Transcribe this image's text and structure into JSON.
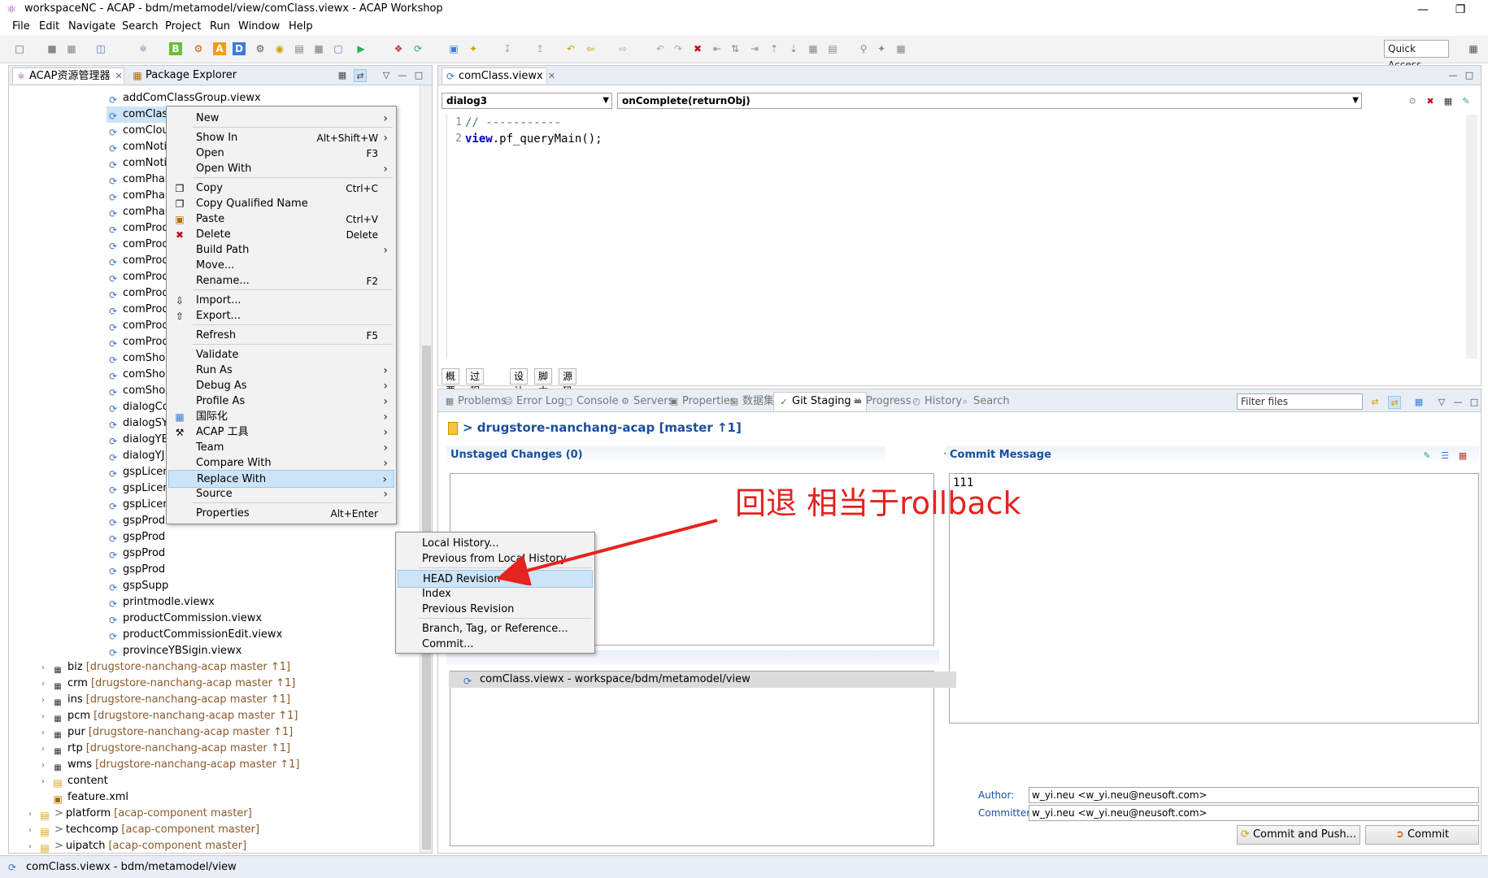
{
  "window": {
    "title": "workspaceNC - ACAP - bdm/metamodel/view/comClass.viewx - ACAP Workshop",
    "minimize": "—",
    "restore": "❐"
  },
  "menubar": [
    "File",
    "Edit",
    "Navigate",
    "Search",
    "Project",
    "Run",
    "Window",
    "Help"
  ],
  "toolbar": {
    "quick_access": "Quick Access"
  },
  "left_panel": {
    "tabs": [
      {
        "label": "ACAP资源管理器",
        "close": "✕"
      },
      {
        "label": "Package Explorer"
      }
    ],
    "tree_items": [
      "addComClassGroup.viewx",
      "comClass",
      "comClou",
      "comNoti",
      "comNoti",
      "comPhar",
      "comPhar",
      "comPhar",
      "comProd",
      "comProd",
      "comProd",
      "comProd",
      "comProd",
      "comProd",
      "comProd",
      "comProd",
      "comShop",
      "comShop",
      "comShop",
      "dialogCo",
      "dialogSY",
      "dialogYB",
      "dialogYJ",
      "gspLicen",
      "gspLicen",
      "gspLicen",
      "gspProd",
      "gspProd",
      "gspProd",
      "gspProd",
      "gspSupp",
      "printmodle.viewx",
      "productCommission.viewx",
      "productCommissionEdit.viewx",
      "provinceYBSigin.viewx"
    ],
    "projects": [
      {
        "name": "biz",
        "git": "[drugstore-nanchang-acap master ↑1]"
      },
      {
        "name": "crm",
        "git": "[drugstore-nanchang-acap master ↑1]"
      },
      {
        "name": "ins",
        "git": "[drugstore-nanchang-acap master ↑1]"
      },
      {
        "name": "pcm",
        "git": "[drugstore-nanchang-acap master ↑1]"
      },
      {
        "name": "pur",
        "git": "[drugstore-nanchang-acap master ↑1]"
      },
      {
        "name": "rtp",
        "git": "[drugstore-nanchang-acap master ↑1]"
      },
      {
        "name": "wms",
        "git": "[drugstore-nanchang-acap master ↑1]"
      }
    ],
    "folders": [
      "content",
      "feature.xml"
    ],
    "root_projects": [
      {
        "name": "platform",
        "git": "[acap-component master]"
      },
      {
        "name": "techcomp",
        "git": "[acap-component master]"
      },
      {
        "name": "uipatch",
        "git": "[acap-component master]"
      }
    ]
  },
  "status_bar": {
    "text": "comClass.viewx - bdm/metamodel/view"
  },
  "editor": {
    "tab": "comClass.viewx",
    "tab_close": "✕",
    "select_left": "dialog3",
    "select_right": "onComplete(returnObj)",
    "lines": [
      {
        "no": "1",
        "text": "// -----------"
      },
      {
        "no": "2",
        "kw": "view",
        "rest": ".pf_queryMain();"
      }
    ],
    "bottom_tabs": [
      "概要",
      "过程调用",
      "设计",
      "脚本",
      "源码"
    ]
  },
  "bottom_panel": {
    "tabs": [
      {
        "label": "Problems",
        "icon": "problems-icon"
      },
      {
        "label": "Error Log",
        "icon": "error-log-icon"
      },
      {
        "label": "Console",
        "icon": "console-icon"
      },
      {
        "label": "Servers",
        "icon": "servers-icon"
      },
      {
        "label": "Properties",
        "icon": "properties-icon"
      },
      {
        "label": "数据集",
        "icon": "dataset-icon"
      },
      {
        "label": "Git Staging",
        "icon": "git-staging-icon",
        "active": true
      },
      {
        "label": "Progress",
        "icon": "progress-icon"
      },
      {
        "label": "History",
        "icon": "history-icon"
      },
      {
        "label": "Search",
        "icon": "search-icon"
      }
    ],
    "filter_placeholder": "Filter files",
    "repo": "> drugstore-nanchang-acap [master ↑1]",
    "unstaged_header": "Unstaged Changes (0)",
    "commit_header": "Commit Message",
    "commit_message": "111",
    "staged_file": "comClass.viewx - workspace/bdm/metamodel/view",
    "author_label": "Author:",
    "author": "w_yi.neu <w_yi.neu@neusoft.com>",
    "committer_label": "Committer:",
    "committer": "w_yi.neu <w_yi.neu@neusoft.com>",
    "commit_push_button": "Commit and Push...",
    "commit_button": "Commit"
  },
  "context_menu": {
    "items": [
      {
        "label": "New",
        "submenu": true
      },
      {
        "sep": true
      },
      {
        "label": "Show In",
        "shortcut": "Alt+Shift+W",
        "submenu": true
      },
      {
        "label": "Open",
        "shortcut": "F3"
      },
      {
        "label": "Open With",
        "submenu": true
      },
      {
        "sep": true
      },
      {
        "label": "Copy",
        "shortcut": "Ctrl+C",
        "icon": "copy-icon"
      },
      {
        "label": "Copy Qualified Name",
        "icon": "copy-qualified-icon"
      },
      {
        "label": "Paste",
        "shortcut": "Ctrl+V",
        "icon": "paste-icon"
      },
      {
        "label": "Delete",
        "shortcut": "Delete",
        "icon": "delete-icon"
      },
      {
        "label": "Build Path",
        "submenu": true
      },
      {
        "label": "Move..."
      },
      {
        "label": "Rename...",
        "shortcut": "F2"
      },
      {
        "sep": true
      },
      {
        "label": "Import...",
        "icon": "import-icon"
      },
      {
        "label": "Export...",
        "icon": "export-icon"
      },
      {
        "sep": true
      },
      {
        "label": "Refresh",
        "shortcut": "F5"
      },
      {
        "sep": true
      },
      {
        "label": "Validate"
      },
      {
        "label": "Run As",
        "submenu": true
      },
      {
        "label": "Debug As",
        "submenu": true
      },
      {
        "label": "Profile As",
        "submenu": true
      },
      {
        "label": "国际化",
        "submenu": true,
        "icon": "i18n-icon"
      },
      {
        "label": "ACAP 工具",
        "submenu": true,
        "icon": "tools-icon"
      },
      {
        "label": "Team",
        "submenu": true
      },
      {
        "label": "Compare With",
        "submenu": true
      },
      {
        "label": "Replace With",
        "submenu": true,
        "highlight": true
      },
      {
        "label": "Source",
        "submenu": true
      },
      {
        "sep": true
      },
      {
        "label": "Properties",
        "shortcut": "Alt+Enter"
      }
    ]
  },
  "submenu": {
    "items": [
      {
        "label": "Local History..."
      },
      {
        "label": "Previous from Local History"
      },
      {
        "sep": true
      },
      {
        "label": "HEAD Revision",
        "highlight": true
      },
      {
        "label": "Index"
      },
      {
        "label": "Previous Revision"
      },
      {
        "sep": true
      },
      {
        "label": "Branch, Tag, or Reference..."
      },
      {
        "label": "Commit..."
      }
    ]
  },
  "annotation": {
    "text": "回退 相当于rollback",
    "color": "#e5231f"
  }
}
